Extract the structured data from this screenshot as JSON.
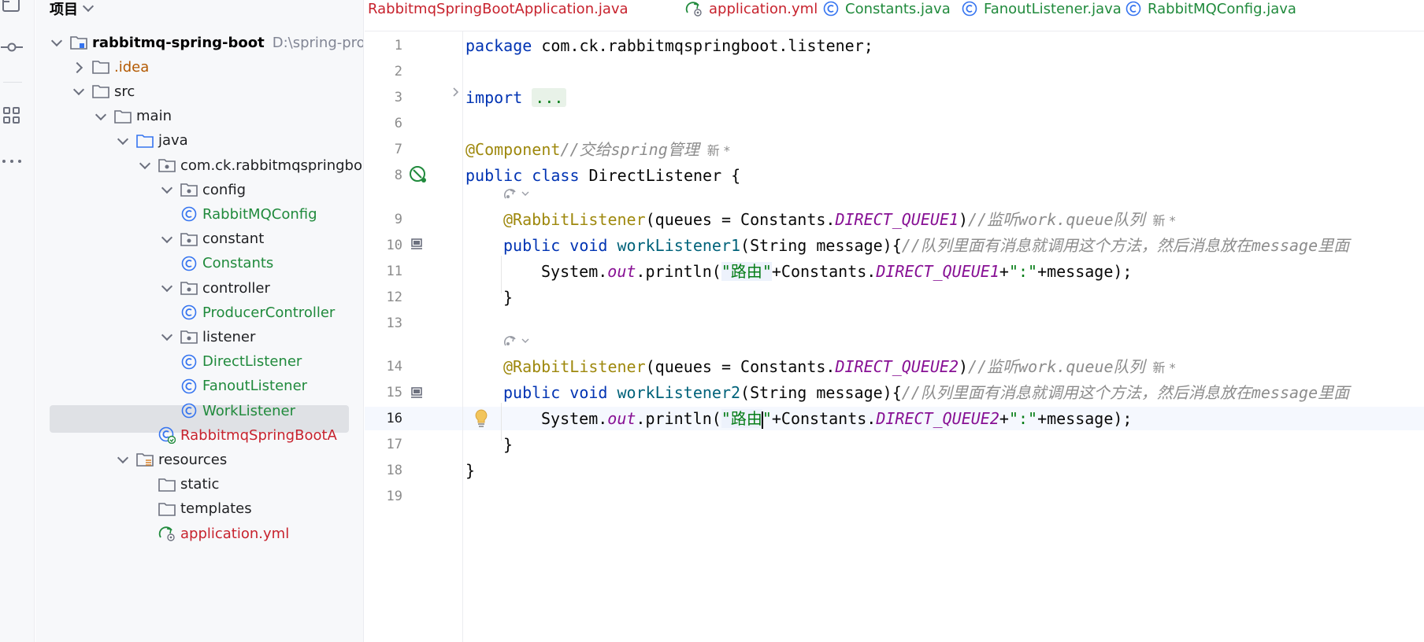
{
  "project_panel": {
    "title": "项目",
    "tree": [
      {
        "label": "rabbitmq-spring-boot",
        "path": "D:\\spring-proje",
        "icon": "module-folder-icon",
        "chevron": "down",
        "style": "bold"
      },
      {
        "label": ".idea",
        "icon": "folder-icon",
        "chevron": "right",
        "style": "brown"
      },
      {
        "label": "src",
        "icon": "folder-icon",
        "chevron": "down",
        "style": "default"
      },
      {
        "label": "main",
        "icon": "folder-icon",
        "chevron": "down",
        "style": "default"
      },
      {
        "label": "java",
        "icon": "source-folder-icon",
        "chevron": "down",
        "style": "default"
      },
      {
        "label": "com.ck.rabbitmqspringbo",
        "icon": "package-icon",
        "chevron": "down",
        "style": "default"
      },
      {
        "label": "config",
        "icon": "package-icon",
        "chevron": "down",
        "style": "default"
      },
      {
        "label": "RabbitMQConfig",
        "icon": "class-icon",
        "chevron": "none",
        "style": "green"
      },
      {
        "label": "constant",
        "icon": "package-icon",
        "chevron": "down",
        "style": "default"
      },
      {
        "label": "Constants",
        "icon": "class-icon",
        "chevron": "none",
        "style": "green"
      },
      {
        "label": "controller",
        "icon": "package-icon",
        "chevron": "down",
        "style": "default"
      },
      {
        "label": "ProducerController",
        "icon": "class-icon",
        "chevron": "none",
        "style": "green"
      },
      {
        "label": "listener",
        "icon": "package-icon",
        "chevron": "down",
        "style": "default"
      },
      {
        "label": "DirectListener",
        "icon": "class-icon",
        "chevron": "none",
        "style": "green"
      },
      {
        "label": "FanoutListener",
        "icon": "class-icon",
        "chevron": "none",
        "style": "green"
      },
      {
        "label": "WorkListener",
        "icon": "class-icon",
        "chevron": "none",
        "style": "green"
      },
      {
        "label": "RabbitmqSpringBootA",
        "icon": "spring-boot-class-icon",
        "chevron": "none",
        "style": "red"
      },
      {
        "label": "resources",
        "icon": "resources-folder-icon",
        "chevron": "down",
        "style": "default"
      },
      {
        "label": "static",
        "icon": "folder-icon",
        "chevron": "none",
        "style": "default"
      },
      {
        "label": "templates",
        "icon": "folder-icon",
        "chevron": "none",
        "style": "default"
      },
      {
        "label": "application.yml",
        "icon": "spring-config-icon",
        "chevron": "none",
        "style": "red"
      }
    ]
  },
  "tabs": [
    {
      "label": "RabbitmqSpringBootApplication.java",
      "icon": "spring-boot-class-icon",
      "style": "red"
    },
    {
      "label": "application.yml",
      "icon": "spring-config-icon",
      "style": "red"
    },
    {
      "label": "Constants.java",
      "icon": "class-icon",
      "style": "green"
    },
    {
      "label": "FanoutListener.java",
      "icon": "class-icon",
      "style": "green"
    },
    {
      "label": "RabbitMQConfig.java",
      "icon": "class-icon",
      "style": "green"
    }
  ],
  "editor": {
    "line_numbers": [
      "1",
      "2",
      "3",
      "6",
      "7",
      "8",
      "9",
      "10",
      "11",
      "12",
      "13",
      "14",
      "15",
      "16",
      "17",
      "18",
      "19"
    ],
    "current_line": "16",
    "code": {
      "l1_kw": "package",
      "l1_rest": " com.ck.rabbitmqspringboot.listener;",
      "l3_kw": "import",
      "l3_folded": "...",
      "l7_ann": "@Component",
      "l7_cmt": "//交给spring管理",
      "l7_hint": "新 *",
      "l8_kw": "public class",
      "l8_rest": " DirectListener {",
      "l9_ann": "@RabbitListener",
      "l9_a": "(queues = Constants.",
      "l9_const": "DIRECT_QUEUE1",
      "l9_b": ")",
      "l9_cmt": "//监听work.queue队列",
      "l9_hint": "新 *",
      "l10_kw": "public void",
      "l10_mth": "workListener1",
      "l10_rest": "(String message){",
      "l10_cmt": "//队列里面有消息就调用这个方法，然后消息放在message里面",
      "l11_a": "System.",
      "l11_fld": "out",
      "l11_b": ".println(",
      "l11_str": "\"路由\"",
      "l11_c": "+Constants.",
      "l11_const": "DIRECT_QUEUE1",
      "l11_d": "+",
      "l11_str2": "\":\"",
      "l11_e": "+message);",
      "l12": "}",
      "l14_ann": "@RabbitListener",
      "l14_a": "(queues = Constants.",
      "l14_const": "DIRECT_QUEUE2",
      "l14_b": ")",
      "l14_cmt": "//监听work.queue队列",
      "l14_hint": "新 *",
      "l15_kw": "public void",
      "l15_mth": "workListener2",
      "l15_rest": "(String message){",
      "l15_cmt": "//队列里面有消息就调用这个方法，然后消息放在message里面",
      "l16_a": "System.",
      "l16_fld": "out",
      "l16_b": ".println(",
      "l16_str_open": "\"路由",
      "l16_str_close": "\"",
      "l16_c": "+Constants.",
      "l16_const": "DIRECT_QUEUE2",
      "l16_d": "+",
      "l16_str2": "\":\"",
      "l16_e": "+message);",
      "l17": "}",
      "l18": "}"
    }
  },
  "colors": {
    "keyword": "#0033b3",
    "annotation": "#9e880d",
    "comment": "#8c8c8c",
    "string": "#067d17",
    "constant": "#871094",
    "method": "#00627a",
    "tab_green": "#208a3c",
    "tab_red": "#c7222d"
  }
}
